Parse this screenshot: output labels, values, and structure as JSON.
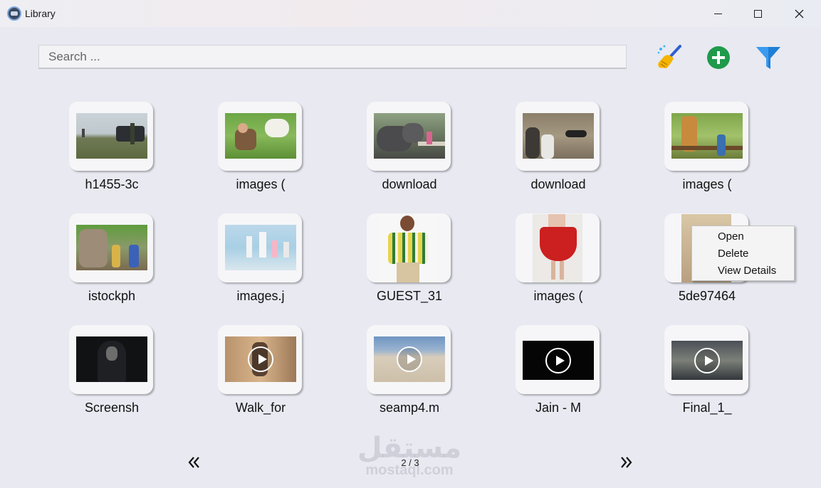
{
  "window": {
    "title": "Library"
  },
  "search": {
    "placeholder": "Search ..."
  },
  "toolbar": {
    "clean_icon": "broom-icon",
    "add_icon": "plus-circle-icon",
    "filter_icon": "funnel-icon"
  },
  "items": [
    {
      "label": "h1455-3c",
      "kind": "image"
    },
    {
      "label": "images (",
      "kind": "image"
    },
    {
      "label": "download",
      "kind": "image"
    },
    {
      "label": "download",
      "kind": "image"
    },
    {
      "label": "images (",
      "kind": "image"
    },
    {
      "label": "istockph",
      "kind": "image"
    },
    {
      "label": "images.j",
      "kind": "image"
    },
    {
      "label": "GUEST_31",
      "kind": "image"
    },
    {
      "label": "images (",
      "kind": "image"
    },
    {
      "label": "5de97464",
      "kind": "image"
    },
    {
      "label": "Screensh",
      "kind": "image"
    },
    {
      "label": "Walk_for",
      "kind": "video"
    },
    {
      "label": "seamp4.m",
      "kind": "video"
    },
    {
      "label": "Jain - M",
      "kind": "video"
    },
    {
      "label": "Final_1_",
      "kind": "video"
    }
  ],
  "context_menu": {
    "items": [
      "Open",
      "Delete",
      "View Details"
    ]
  },
  "pagination": {
    "text": "2 / 3"
  },
  "watermark": {
    "arabic": "مستقل",
    "latin": "mostaql.com"
  },
  "colors": {
    "add": "#1f9a4a",
    "filter": "#1e7fd6",
    "background": "#e8e9f1"
  }
}
